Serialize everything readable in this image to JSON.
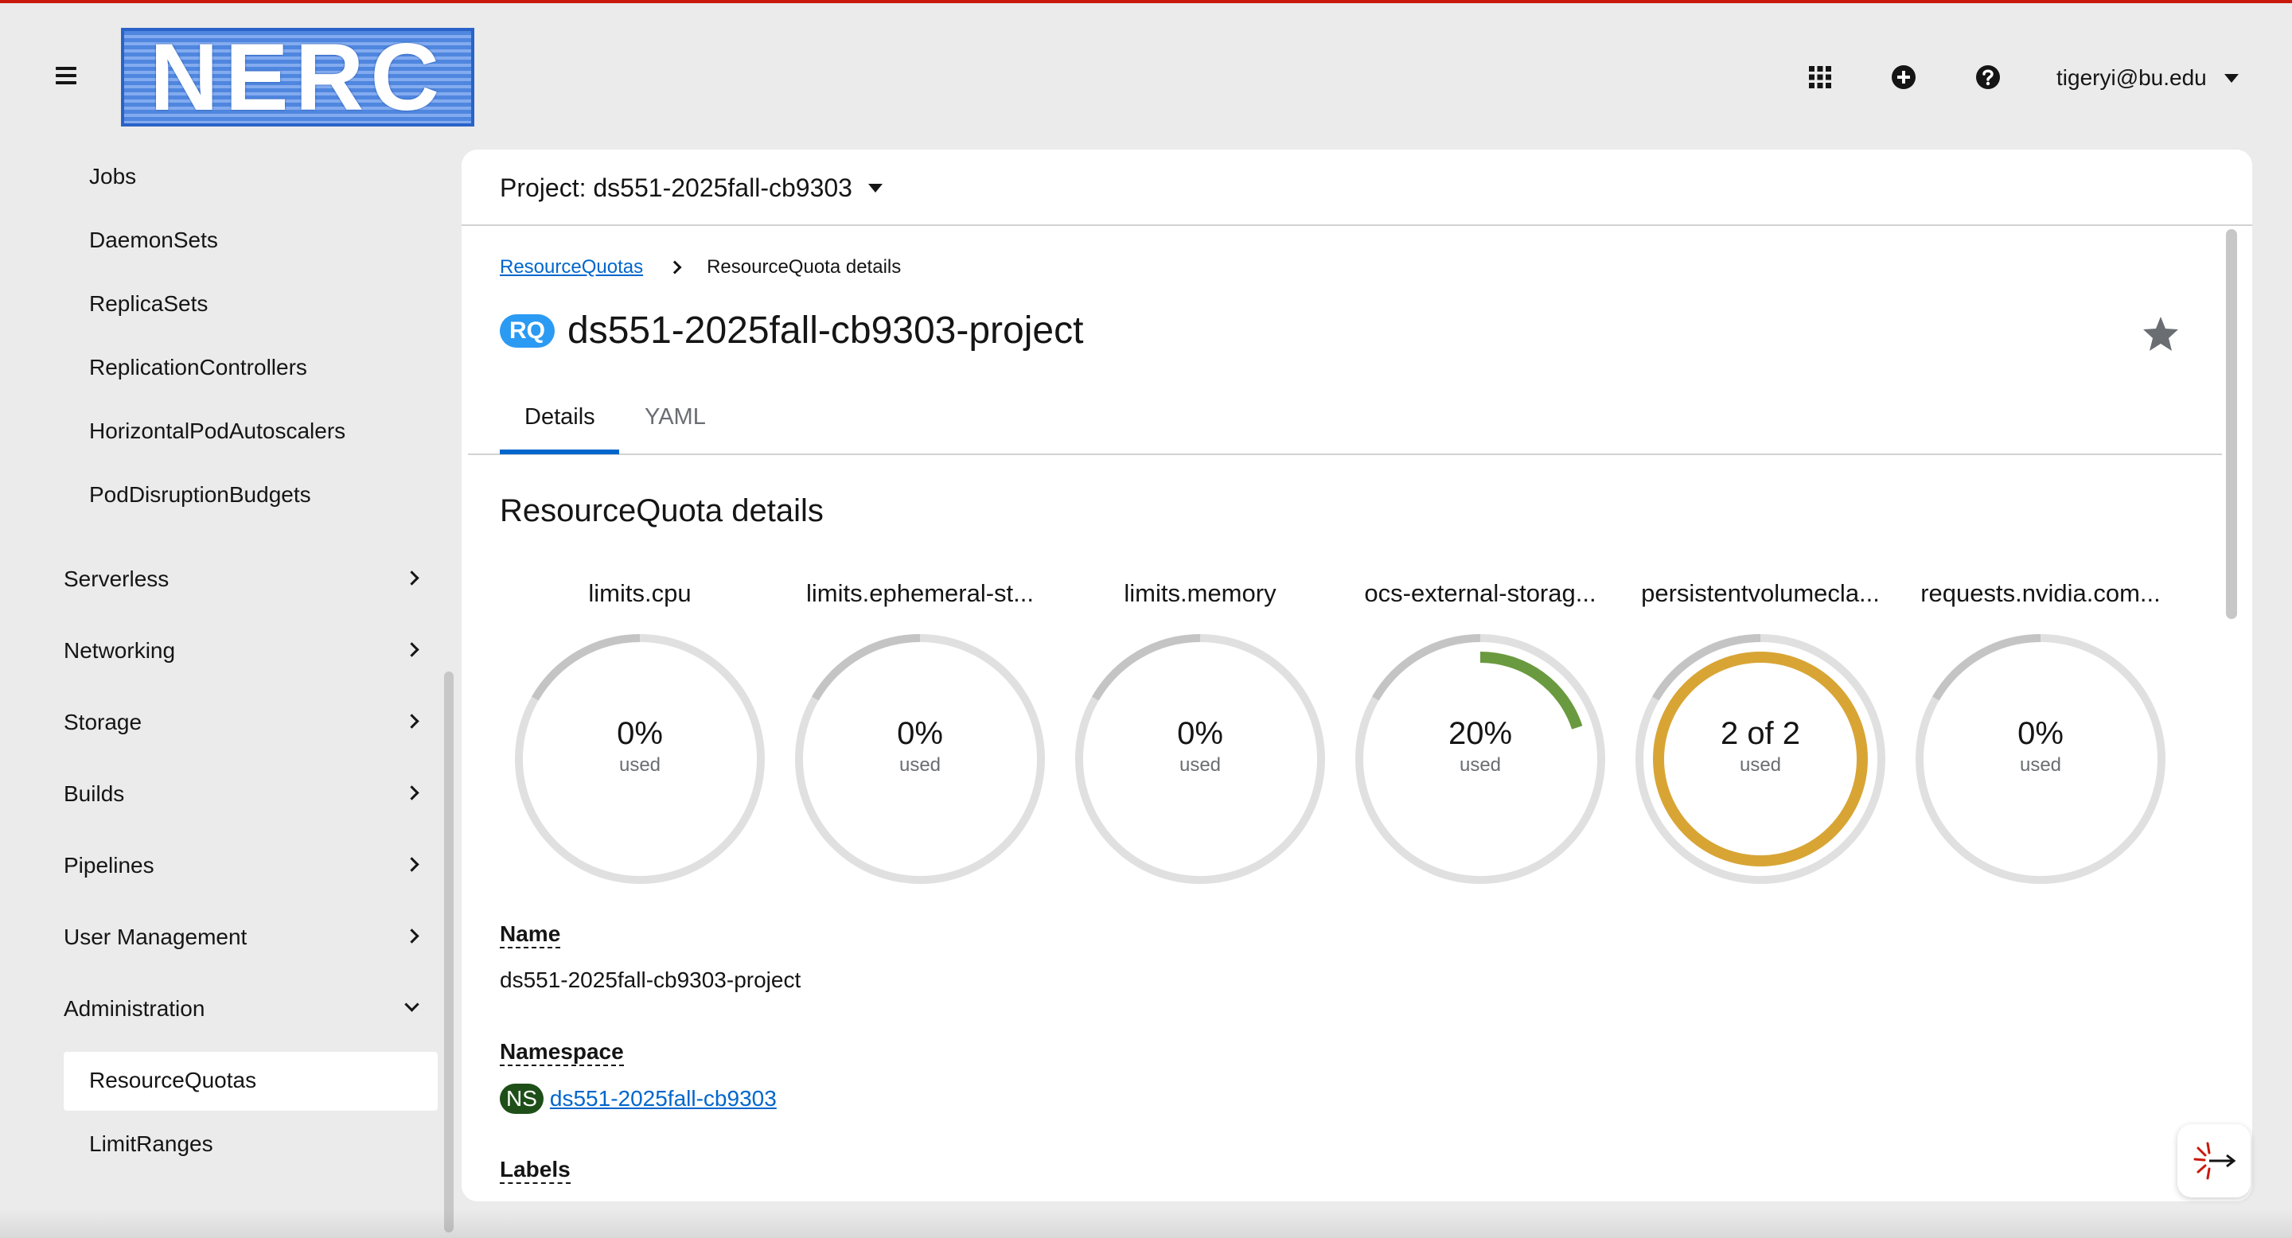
{
  "masthead": {
    "logo_text": "NERC",
    "icons": [
      "app-launcher-icon",
      "plus-circle-icon",
      "help-icon"
    ],
    "user": "tigeryi@bu.edu"
  },
  "sidebar": {
    "sub_items": [
      "Jobs",
      "DaemonSets",
      "ReplicaSets",
      "ReplicationControllers",
      "HorizontalPodAutoscalers",
      "PodDisruptionBudgets"
    ],
    "groups": [
      {
        "label": "Serverless",
        "expanded": false
      },
      {
        "label": "Networking",
        "expanded": false
      },
      {
        "label": "Storage",
        "expanded": false
      },
      {
        "label": "Builds",
        "expanded": false
      },
      {
        "label": "Pipelines",
        "expanded": false
      },
      {
        "label": "User Management",
        "expanded": false
      },
      {
        "label": "Administration",
        "expanded": true
      }
    ],
    "admin_items": [
      {
        "label": "ResourceQuotas",
        "active": true
      },
      {
        "label": "LimitRanges",
        "active": false
      }
    ]
  },
  "project": {
    "label": "Project: ds551-2025fall-cb9303"
  },
  "breadcrumb": {
    "link": "ResourceQuotas",
    "current": "ResourceQuota details"
  },
  "title": {
    "badge": "RQ",
    "name": "ds551-2025fall-cb9303-project"
  },
  "tabs": [
    "Details",
    "YAML"
  ],
  "section_title": "ResourceQuota details",
  "quotas": [
    {
      "label": "limits.cpu",
      "value": "0%",
      "used_text": "used",
      "fraction": 0,
      "color": "#6ca100"
    },
    {
      "label": "limits.ephemeral-st...",
      "value": "0%",
      "used_text": "used",
      "fraction": 0,
      "color": "#6ca100"
    },
    {
      "label": "limits.memory",
      "value": "0%",
      "used_text": "used",
      "fraction": 0,
      "color": "#6ca100"
    },
    {
      "label": "ocs-external-storag...",
      "value": "20%",
      "used_text": "used",
      "fraction": 0.2,
      "color": "#6a9a3f"
    },
    {
      "label": "persistentvolumecla...",
      "value": "2 of 2",
      "used_text": "used",
      "fraction": 1,
      "color": "#d8a535"
    },
    {
      "label": "requests.nvidia.com...",
      "value": "0%",
      "used_text": "used",
      "fraction": 0,
      "color": "#6ca100"
    }
  ],
  "fields": {
    "name_label": "Name",
    "name_value": "ds551-2025fall-cb9303-project",
    "namespace_label": "Namespace",
    "namespace_badge": "NS",
    "namespace_value": "ds551-2025fall-cb9303",
    "labels_label": "Labels"
  }
}
